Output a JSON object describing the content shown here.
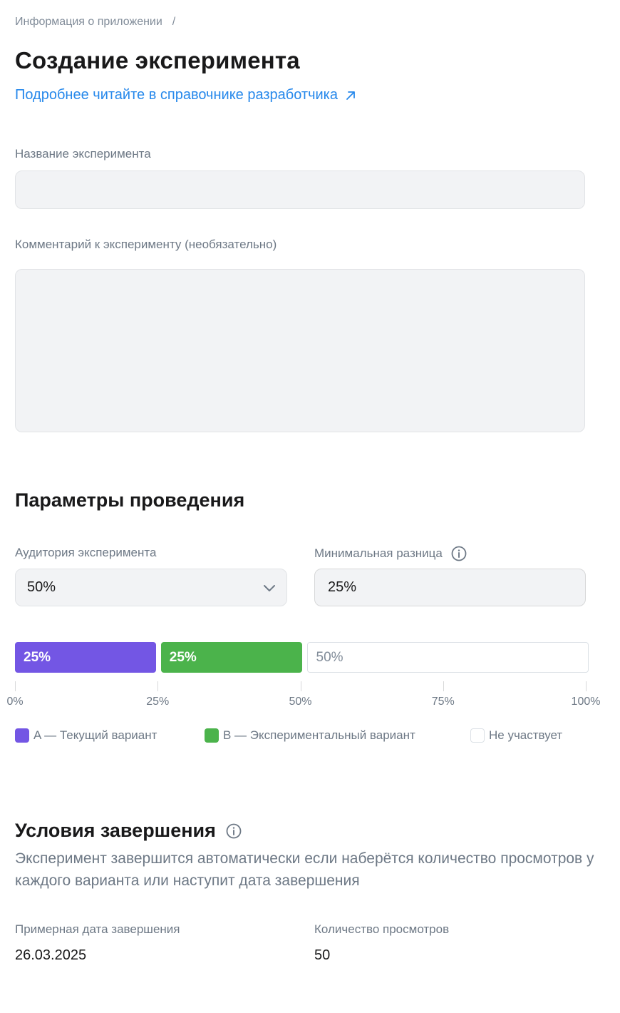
{
  "breadcrumb": {
    "items": [
      "Информация о приложении"
    ],
    "separator": "/"
  },
  "page_title": "Создание эксперимента",
  "doc_link": {
    "label": "Подробнее читайте в справочнике разработчика",
    "icon": "external-arrow-icon"
  },
  "form": {
    "name_label": "Название эксперимента",
    "name_value": "",
    "comment_label": "Комментарий к эксперименту (необязательно)",
    "comment_value": ""
  },
  "params": {
    "title": "Параметры проведения",
    "audience_label": "Аудитория эксперимента",
    "audience_value": "50%",
    "min_diff_label": "Минимальная разница",
    "min_diff_value": "25%",
    "distribution": {
      "segments": [
        {
          "name": "A",
          "percent": 25,
          "label": "25%",
          "color": "#7356e4"
        },
        {
          "name": "B",
          "percent": 25,
          "label": "25%",
          "color": "#4bb34b"
        },
        {
          "name": "none",
          "percent": 50,
          "label": "50%",
          "color": "#ffffff"
        }
      ],
      "axis_ticks": [
        "0%",
        "25%",
        "50%",
        "75%",
        "100%"
      ]
    },
    "legend": [
      {
        "label": "A — Текущий вариант",
        "color": "#7356e4"
      },
      {
        "label": "B — Экспериментальный вариант",
        "color": "#4bb34b"
      },
      {
        "label": "Не участвует",
        "color": "#ffffff"
      }
    ]
  },
  "completion": {
    "title": "Условия завершения",
    "description": "Эксперимент завершится автоматически если наберётся количество просмотров у каждого варианта или наступит дата завершения",
    "date_label": "Примерная дата завершения",
    "date_value": "26.03.2025",
    "views_label": "Количество просмотров",
    "views_value": "50"
  },
  "colors": {
    "link": "#2688eb",
    "variant_a": "#7356e4",
    "variant_b": "#4bb34b",
    "muted_text": "#6d7885"
  }
}
